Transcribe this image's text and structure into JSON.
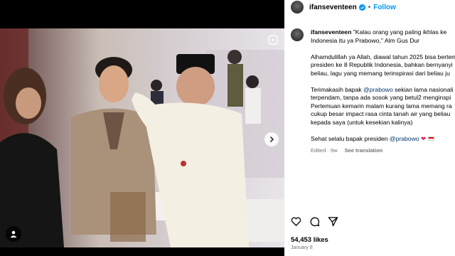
{
  "post": {
    "username": "ifanseventeen",
    "follow_label": "Follow",
    "separator": "•"
  },
  "caption": {
    "username": "ifanseventeen",
    "lines": [
      "\"Kalau orang yang paling ikhlas ke",
      "Indonesia itu ya Prabowo,\" Alm Gus Dur",
      "",
      "Alhamdulillah ya Allah, diawal tahun 2025 bisa bertem",
      "presiden ke 8 Republik Indonesia, bahkan bernyanyi",
      "beliau, lagu yang memang terinspirasi dari beliau ju",
      "",
      "Terimakasih bapak",
      "terpendam, tanpa ada sosok yang betul2 menginspi",
      "Pertemuan kemarin malam kurang lama memang ra",
      "cukup besar impact rasa cinta tanah air yang beliau",
      "kepada saya (untuk kesekian kalinya)",
      "",
      "Sehat selalu bapak presiden"
    ],
    "mention": "@prabowo",
    "terimakasih_tail": " sekian lama nasionali",
    "edited": "Edited · 9w",
    "see_translation": "See translation"
  },
  "actions": {
    "icons": [
      "heart-icon",
      "comment-icon",
      "share-icon"
    ]
  },
  "likes": "54,453 likes",
  "date": "January 8",
  "colors": {
    "accent": "#0095f6",
    "mention": "#00376b"
  }
}
